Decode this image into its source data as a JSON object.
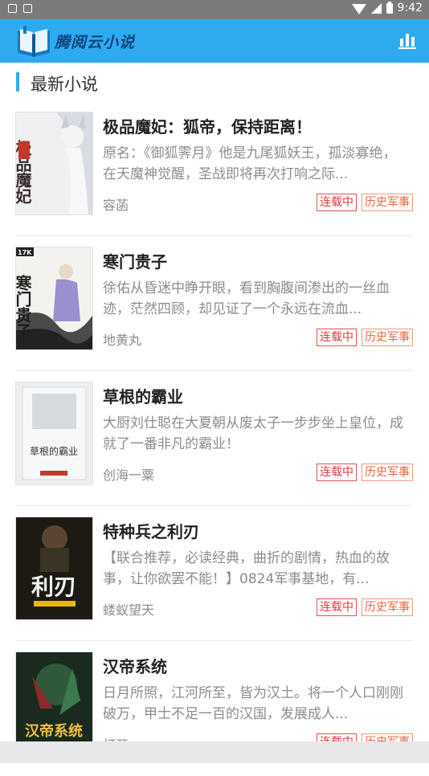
{
  "status_bar": {
    "time": "9:42"
  },
  "app_bar": {
    "title": "腾阅云小说",
    "rank_icon": "bar-chart-icon"
  },
  "section": {
    "title": "最新小说"
  },
  "books": [
    {
      "title": "极品魔妃：狐帝，保持距离！",
      "desc": "原名：《御狐霁月》他是九尾狐妖王，孤淡寡绝，在天魔神觉醒，圣战即将再次打响之际...",
      "author": "容菡",
      "status": "连载中",
      "category": "历史军事",
      "cover_text": "极品魔妃"
    },
    {
      "title": "寒门贵子",
      "desc": "徐佑从昏迷中睁开眼，看到胸腹间渗出的一丝血迹，茫然四顾，却见证了一个永远在流血...",
      "author": "地黄丸",
      "status": "连载中",
      "category": "历史军事",
      "cover_text": "寒门贵子"
    },
    {
      "title": "草根的霸业",
      "desc": "大厨刘仕聪在大夏朝从废太子一步步坐上皇位，成就了一番非凡的霸业！",
      "author": "创海一粟",
      "status": "连载中",
      "category": "历史军事",
      "cover_text": "草根的霸业"
    },
    {
      "title": "特种兵之利刃",
      "desc": "【联合推荐，必读经典，曲折的剧情，热血的故事，让你欲罢不能！】0824军事基地，有...",
      "author": "蝼蚁望天",
      "status": "连载中",
      "category": "历史军事",
      "cover_text": "利刃"
    },
    {
      "title": "汉帝系统",
      "desc": "日月所照，江河所至，皆为汉土。将一个人口刚刚破万，甲士不足一百的汉国，发展成人...",
      "author": "打开",
      "status": "连载中",
      "category": "历史军事",
      "cover_text": "汉帝系统"
    }
  ]
}
